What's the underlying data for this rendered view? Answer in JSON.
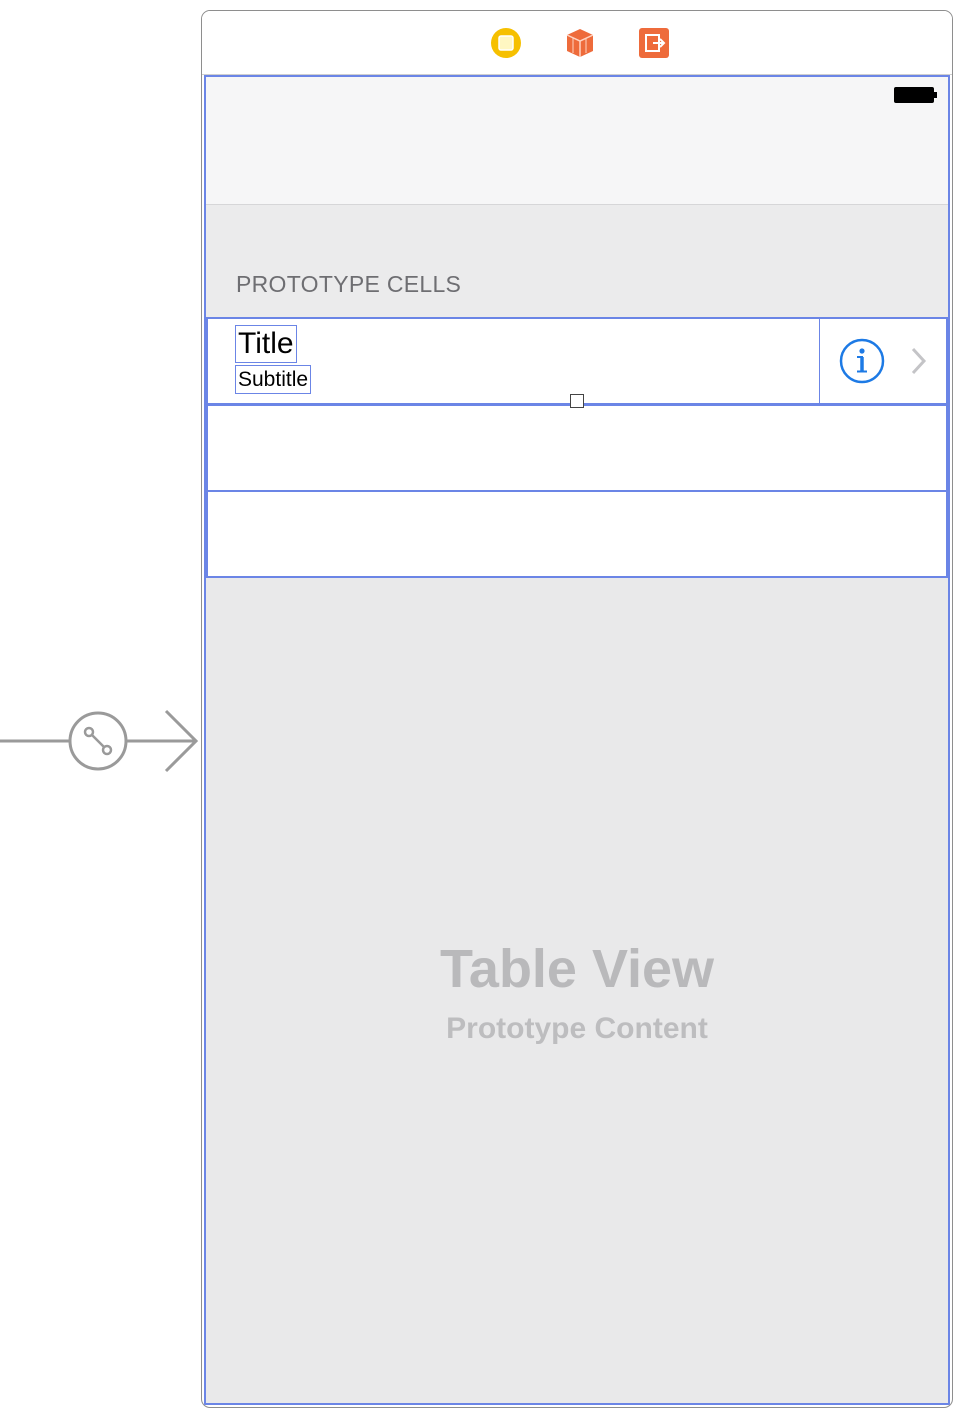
{
  "segue": {
    "icon": "initial-view-controller-arrow-icon"
  },
  "scene_dock": {
    "icons": [
      "view-controller-icon",
      "first-responder-icon",
      "exit-icon"
    ],
    "colors": {
      "view_controller": "#f6c000",
      "first_responder": "#ee6b3b",
      "exit": "#ee6b3b"
    }
  },
  "status_bar": {
    "battery_icon": "battery-icon"
  },
  "table": {
    "section_header": "PROTOTYPE CELLS",
    "cell": {
      "title": "Title",
      "subtitle": "Subtitle",
      "accessory_icons": [
        "info-icon",
        "chevron-right-icon"
      ]
    },
    "placeholder_title": "Table View",
    "placeholder_subtitle": "Prototype Content"
  },
  "colors": {
    "selection_outline": "#6b85e6",
    "accessory_tint": "#1d7ae5"
  }
}
